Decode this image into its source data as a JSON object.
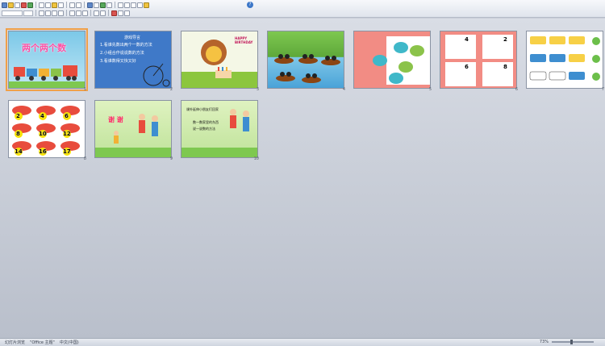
{
  "app": {
    "zoom": "73%",
    "status_left": "幻灯片浏览",
    "status_mid": "\"Office 主题\"",
    "status_lang": "中文(中国)"
  },
  "slides": [
    {
      "n": "1",
      "title": "两个两个数",
      "theme": "title"
    },
    {
      "n": "2",
      "heading": "游戏导言",
      "lines": [
        "1.看谁先数出两个一数的方法",
        "2.小组合作说说数的方法",
        "3.看谁数得又快又好"
      ],
      "theme": "text"
    },
    {
      "n": "3",
      "theme": "lion",
      "banner": "HAPPY BIRTHDAY"
    },
    {
      "n": "4",
      "theme": "boats"
    },
    {
      "n": "5",
      "theme": "candy"
    },
    {
      "n": "6",
      "theme": "bags",
      "labels": [
        "2",
        "4",
        "6",
        "8"
      ]
    },
    {
      "n": "7",
      "theme": "cars"
    },
    {
      "n": "8",
      "theme": "numbers",
      "values": [
        "2",
        "4",
        "6",
        "8",
        "10",
        "12",
        "14",
        "16",
        "17"
      ]
    },
    {
      "n": "9",
      "theme": "thanks",
      "title": "谢 谢"
    },
    {
      "n": "10",
      "theme": "notes",
      "lines": [
        "课外延伸小朋友们回家",
        "数一数家里的东西",
        "说一说数的方法"
      ]
    }
  ]
}
